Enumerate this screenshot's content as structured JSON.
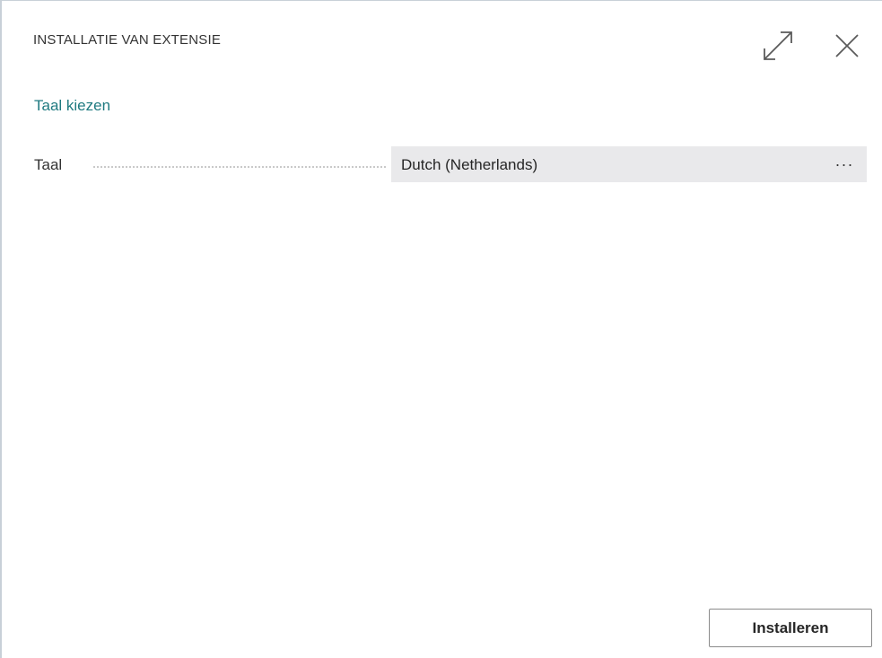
{
  "dialog": {
    "title": "INSTALLATIE VAN EXTENSIE",
    "expand_icon": "expand-icon",
    "close_icon": "close-icon"
  },
  "section": {
    "title": "Taal kiezen"
  },
  "fields": [
    {
      "label": "Taal",
      "value": "Dutch (Netherlands)",
      "lookup_label": "···"
    }
  ],
  "actions": {
    "install_label": "Installeren"
  },
  "colors": {
    "accent": "#1f7a80",
    "field_background": "#e9e9eb",
    "text": "#333333"
  }
}
